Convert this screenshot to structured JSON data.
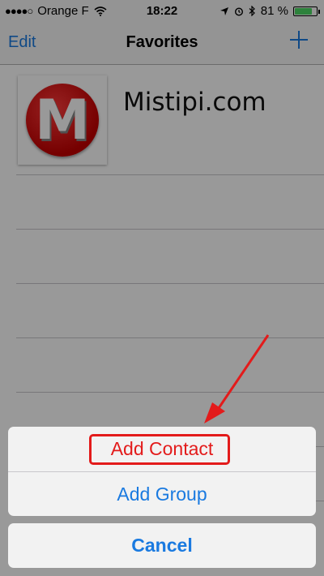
{
  "status_bar": {
    "signal": "●●●●○",
    "carrier": "Orange F",
    "time": "18:22",
    "battery_percent": "81 %",
    "battery_level": 0.81,
    "icons": [
      "wifi-icon",
      "location-arrow-icon",
      "alarm-icon",
      "bluetooth-icon",
      "battery-icon"
    ]
  },
  "navbar": {
    "edit_label": "Edit",
    "title": "Favorites",
    "add_icon": "plus-icon"
  },
  "favorites": [
    {
      "name": "Mistipi.com",
      "avatar_letter": "M"
    }
  ],
  "action_sheet": {
    "add_contact_label": "Add Contact",
    "add_group_label": "Add Group",
    "cancel_label": "Cancel"
  },
  "annotation": {
    "color": "#e31b1b",
    "icons": [
      "red-arrow",
      "red-highlight-box"
    ]
  },
  "colors": {
    "accent": "#1a7ae0",
    "battery": "#4cd964"
  }
}
